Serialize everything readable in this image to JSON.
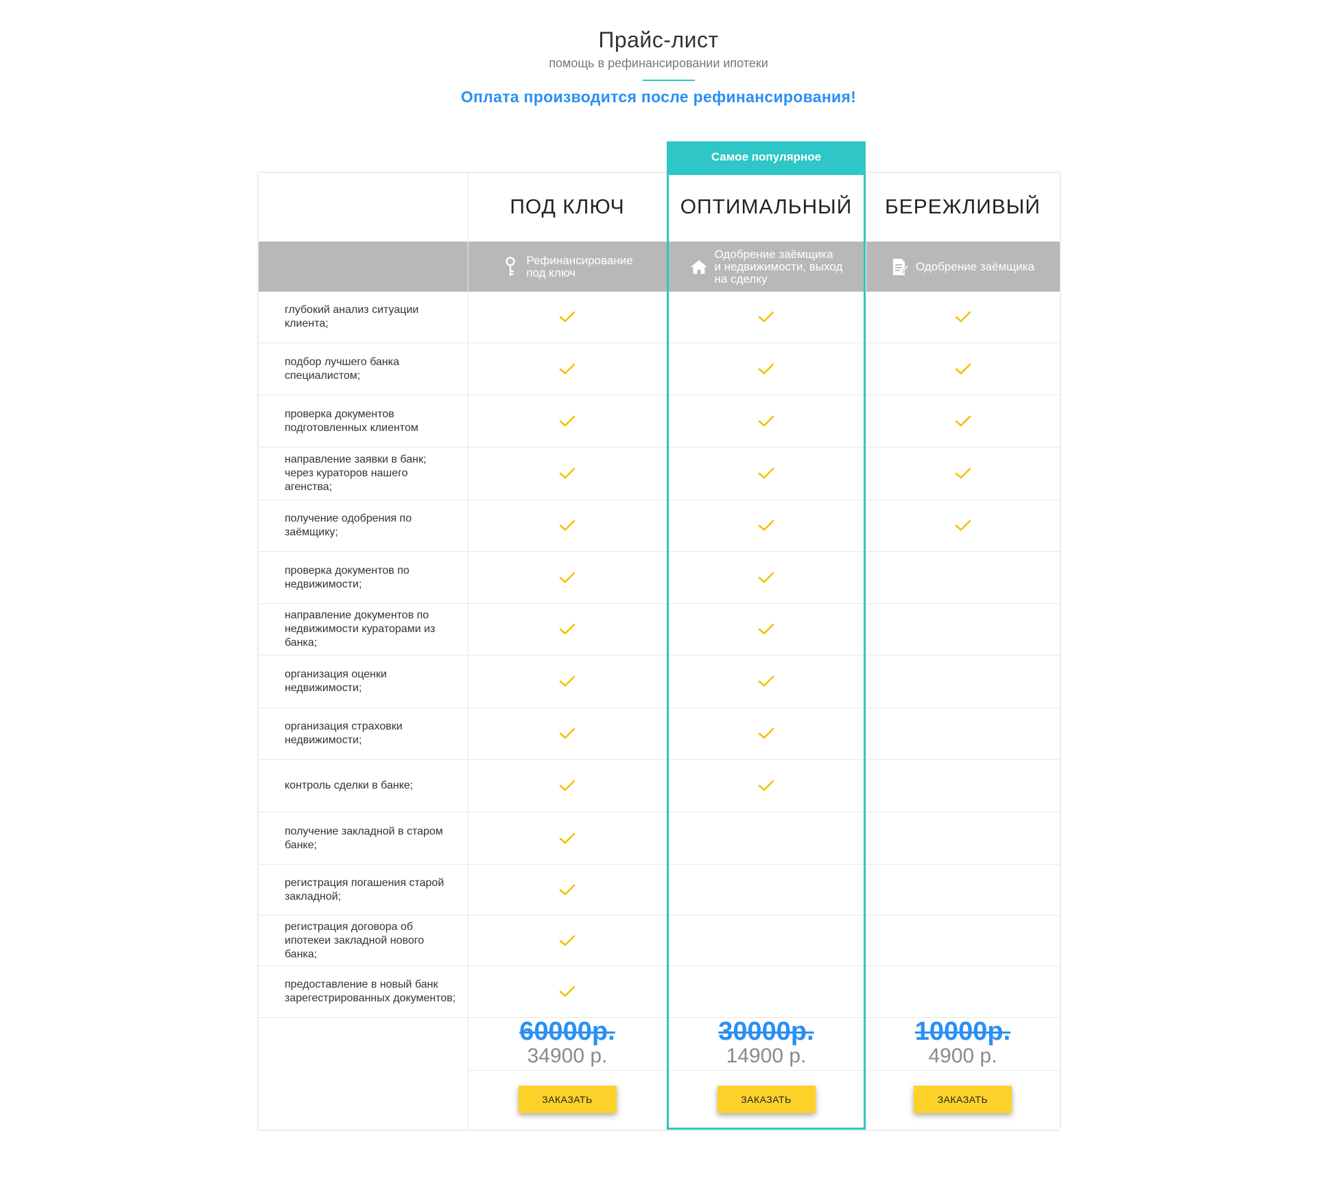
{
  "header": {
    "title": "Прайс-лист",
    "subtitle": "помощь в рефинансировании ипотеки",
    "notice": "Оплата производится после рефинансирования!"
  },
  "popular_badge": "Самое популярное",
  "colors": {
    "accent": "#2ec6c6",
    "price_old": "#2b8ff3",
    "button": "#fcd22a",
    "check": "#f2c200",
    "band": "#b8b8b8"
  },
  "plans": [
    {
      "name": "ПОД КЛЮЧ",
      "icon": "key-icon",
      "description": "Рефинансирование\nпод ключ",
      "old_price": "60000р.",
      "new_price": "34900 р.",
      "button": "ЗАКАЗАТЬ"
    },
    {
      "name": "ОПТИМАЛЬНЫЙ",
      "icon": "house-icon",
      "description": "Одобрение заёмщика\nи недвижимости, выход\nна сделку",
      "old_price": "30000р.",
      "new_price": "14900 р.",
      "button": "ЗАКАЗАТЬ"
    },
    {
      "name": "БЕРЕЖЛИВЫЙ",
      "icon": "document-icon",
      "description": "Одобрение заёмщика",
      "old_price": "10000р.",
      "new_price": "4900 р.",
      "button": "ЗАКАЗАТЬ"
    }
  ],
  "features": [
    {
      "label": "глубокий анализ ситуации клиента;",
      "included": [
        true,
        true,
        true
      ]
    },
    {
      "label": "подбор лучшего банка специалистом;",
      "included": [
        true,
        true,
        true
      ]
    },
    {
      "label": "проверка документов подготовленных клиентом",
      "included": [
        true,
        true,
        true
      ]
    },
    {
      "label": "направление заявки в банк; через кураторов нашего агенства;",
      "included": [
        true,
        true,
        true
      ]
    },
    {
      "label": "получение одобрения по заёмщику;",
      "included": [
        true,
        true,
        true
      ]
    },
    {
      "label": "проверка документов по недвижимости;",
      "included": [
        true,
        true,
        false
      ]
    },
    {
      "label": "направление документов по недвижимости кураторами из банка;",
      "included": [
        true,
        true,
        false
      ]
    },
    {
      "label": "организация оценки недвижимости;",
      "included": [
        true,
        true,
        false
      ]
    },
    {
      "label": "организация страховки недвижимости;",
      "included": [
        true,
        true,
        false
      ]
    },
    {
      "label": "контроль сделки в банке;",
      "included": [
        true,
        true,
        false
      ]
    },
    {
      "label": "получение закладной в старом банке;",
      "included": [
        true,
        false,
        false
      ]
    },
    {
      "label": "регистрация погашения старой закладной;",
      "included": [
        true,
        false,
        false
      ]
    },
    {
      "label": "регистрация договора об ипотекеи закладной нового банка;",
      "included": [
        true,
        false,
        false
      ]
    },
    {
      "label": "предоставление в новый банк зарегестрированных документов;",
      "included": [
        true,
        false,
        false
      ]
    }
  ]
}
